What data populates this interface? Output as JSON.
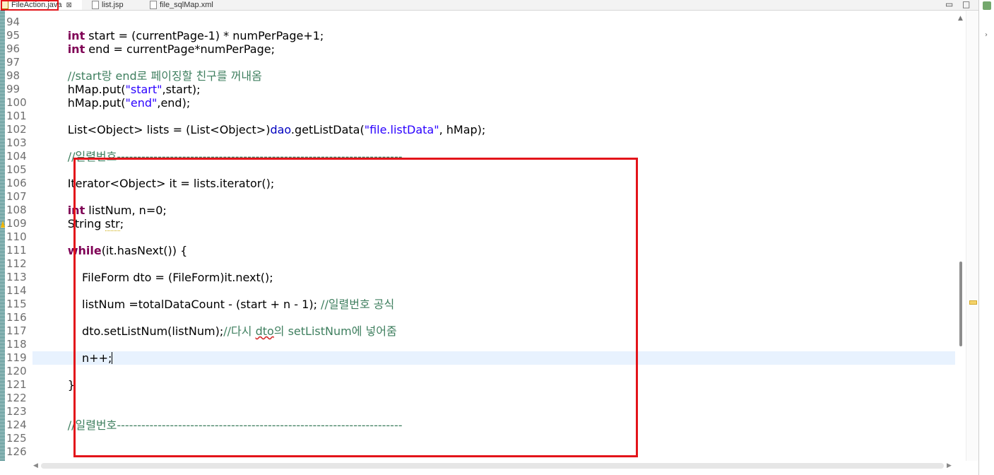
{
  "tabs": [
    {
      "label": "FileAction.java",
      "close": "⊠",
      "active": true
    },
    {
      "label": "list.jsp",
      "active": false
    },
    {
      "label": "file_sqlMap.xml",
      "active": false
    }
  ],
  "window_controls": {
    "minimize": "▭",
    "maximize": "□"
  },
  "lines": [
    {
      "n": "94",
      "html": ""
    },
    {
      "n": "95",
      "html": "        <span class=\"kw\">int</span> start = (currentPage-1) * numPerPage+1;"
    },
    {
      "n": "96",
      "html": "        <span class=\"kw\">int</span> end = currentPage*numPerPage;"
    },
    {
      "n": "97",
      "html": ""
    },
    {
      "n": "98",
      "html": "        <span class=\"cm\">//start랑 end로 페이징할 친구를 꺼내옴</span>"
    },
    {
      "n": "99",
      "html": "        hMap.put(<span class=\"str\">\"start\"</span>,start);"
    },
    {
      "n": "100",
      "html": "        hMap.put(<span class=\"str\">\"end\"</span>,end);"
    },
    {
      "n": "101",
      "html": ""
    },
    {
      "n": "102",
      "html": "        List&lt;Object&gt; lists = (List&lt;Object&gt;)<span class=\"fld\">dao</span>.getListData(<span class=\"str\">\"file.listData\"</span>, hMap);"
    },
    {
      "n": "103",
      "html": ""
    },
    {
      "n": "104",
      "html": "        <span class=\"cm\">//일렬번호----------------------------------------------------------------------</span>"
    },
    {
      "n": "105",
      "html": ""
    },
    {
      "n": "106",
      "html": "        Iterator&lt;Object&gt; it = lists.iterator();"
    },
    {
      "n": "107",
      "html": ""
    },
    {
      "n": "108",
      "html": "        <span class=\"kw\">int</span> listNum, n=0;"
    },
    {
      "n": "109",
      "html": "        String <span class=\"warn\">str</span>;"
    },
    {
      "n": "110",
      "html": ""
    },
    {
      "n": "111",
      "html": "        <span class=\"kw\">while</span>(it.hasNext()) {"
    },
    {
      "n": "112",
      "html": ""
    },
    {
      "n": "113",
      "html": "            FileForm dto = (FileForm)it.next();"
    },
    {
      "n": "114",
      "html": ""
    },
    {
      "n": "115",
      "html": "            listNum =totalDataCount - (start + n - 1); <span class=\"cm\">//일렬번호 공식</span>"
    },
    {
      "n": "116",
      "html": ""
    },
    {
      "n": "117",
      "html": "            dto.setListNum(listNum);<span class=\"cm\">//다시 <span class=\"squig\">dto</span>의 setListNum에 넣어줌</span>"
    },
    {
      "n": "118",
      "html": ""
    },
    {
      "n": "119",
      "html": "            n++;<span class=\"cursor\"></span>",
      "current": true
    },
    {
      "n": "120",
      "html": ""
    },
    {
      "n": "121",
      "html": "        }"
    },
    {
      "n": "122",
      "html": ""
    },
    {
      "n": "123",
      "html": ""
    },
    {
      "n": "124",
      "html": "        <span class=\"cm\">//일렬번호----------------------------------------------------------------------</span>"
    },
    {
      "n": "125",
      "html": ""
    },
    {
      "n": "126",
      "html": ""
    }
  ],
  "scroll": {
    "left_arrow": "◀",
    "right_arrow": "▶",
    "up_arrow": "▲"
  },
  "colors": {
    "keyword": "#7f0055",
    "string": "#2a00ff",
    "comment": "#3f7f5f",
    "highlight_box": "#e3141a"
  }
}
